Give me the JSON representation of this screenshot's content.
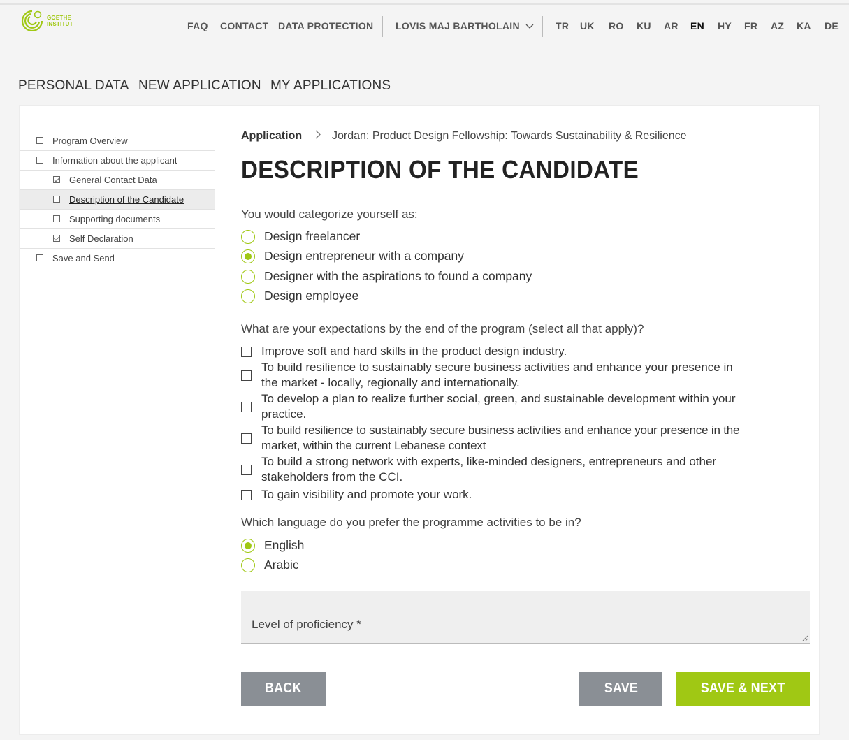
{
  "header": {
    "logo_line1": "GOETHE",
    "logo_line2": "INSTITUT",
    "nav": [
      "FAQ",
      "CONTACT",
      "DATA PROTECTION"
    ],
    "user": "LOVIS MAJ BARTHOLAIN",
    "languages": [
      "TR",
      "UK",
      "RO",
      "KU",
      "AR",
      "EN",
      "HY",
      "FR",
      "AZ",
      "KA",
      "DE"
    ],
    "active_language": "EN",
    "accent_color": "#a0c814"
  },
  "main_tabs": [
    "PERSONAL DATA",
    "NEW APPLICATION",
    "MY APPLICATIONS"
  ],
  "sidebar": {
    "items": [
      {
        "label": "Program Overview",
        "level": 0,
        "checked": false
      },
      {
        "label": "Information about the applicant",
        "level": 0,
        "checked": false
      },
      {
        "label": "General Contact Data",
        "level": 1,
        "checked": true
      },
      {
        "label": "Description of the Candidate",
        "level": 1,
        "checked": false,
        "active": true
      },
      {
        "label": "Supporting documents",
        "level": 1,
        "checked": false
      },
      {
        "label": "Self Declaration",
        "level": 1,
        "checked": true
      },
      {
        "label": "Save and Send",
        "level": 0,
        "checked": false
      }
    ]
  },
  "breadcrumb": {
    "root": "Application",
    "current": "Jordan: Product Design Fellowship: Towards Sustainability & Resilience"
  },
  "page_title": "DESCRIPTION OF THE CANDIDATE",
  "q1": {
    "label": "You would categorize yourself as:",
    "options": [
      "Design freelancer",
      "Design entrepreneur with a company",
      "Designer with the aspirations to found a company",
      "Design employee"
    ],
    "selected": "Design entrepreneur with a company"
  },
  "q2": {
    "label": "What are your expectations by the end of the program (select all that apply)?",
    "options": [
      {
        "lines": [
          "Improve soft and hard skills in the product design industry."
        ]
      },
      {
        "lines": [
          "To build resilience to sustainably secure business activities and enhance your presence in",
          "the market - locally, regionally and internationally."
        ]
      },
      {
        "lines": [
          "To develop a plan to realize further social, green, and sustainable development within your",
          "practice."
        ]
      },
      {
        "lines": [
          "To build resilience to sustainably secure business activities and enhance your presence in the",
          "market, within the current Lebanese context"
        ]
      },
      {
        "lines": [
          "To build a strong network with experts, like-minded designers, entrepreneurs and other",
          "stakeholders from the CCI."
        ]
      },
      {
        "lines": [
          "To gain visibility and promote your work."
        ]
      }
    ]
  },
  "q3": {
    "label": "Which language do you prefer the programme activities to be in?",
    "options": [
      "English",
      "Arabic"
    ],
    "selected": "English"
  },
  "proficiency": {
    "placeholder": "Level of proficiency *"
  },
  "buttons": {
    "back": "BACK",
    "save": "SAVE",
    "save_next": "SAVE & NEXT"
  }
}
